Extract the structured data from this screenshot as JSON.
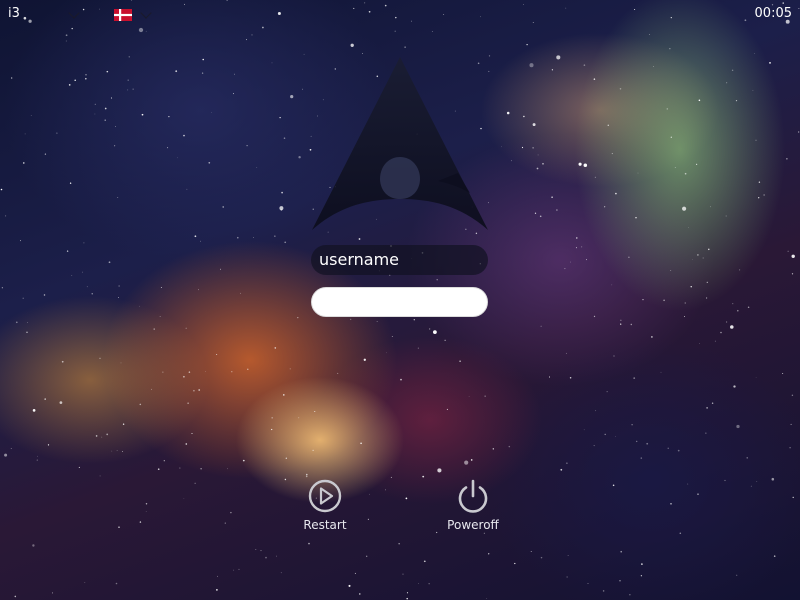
{
  "topbar": {
    "wm_name": "i3",
    "clock": "00:05",
    "keyboard_layout_icon": "denmark-flag-icon"
  },
  "login": {
    "username": "username",
    "password_value": ""
  },
  "actions": {
    "restart_label": "Restart",
    "poweroff_label": "Poweroff"
  },
  "colors": {
    "field_dark": "#121222",
    "field_light": "#ffffff",
    "icon_grey": "#c9c9cf",
    "text": "#ffffff"
  }
}
